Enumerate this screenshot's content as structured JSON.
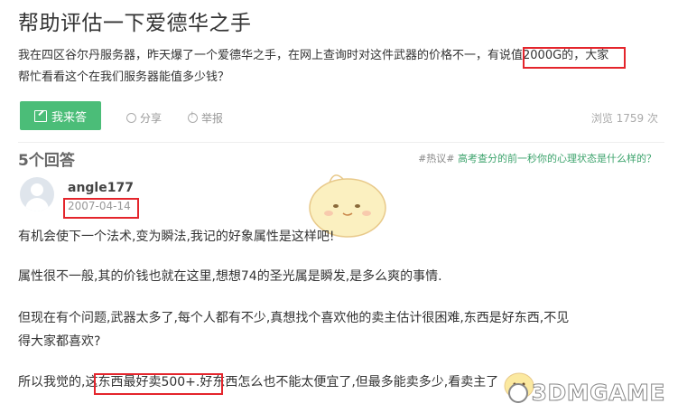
{
  "question": {
    "title": "帮助评估一下爱德华之手",
    "desc_line1_a": "我在四区谷尔丹服务器，昨天爆了一个爱德华之手，在网上查询时对这件武器的价格不一，",
    "desc_line1_b": "有说值2000G的",
    "desc_line1_c": "，大家",
    "desc_line2": "帮忙看看这个在我们服务器能值多少钱？"
  },
  "actions": {
    "answer_label": "我来答",
    "share_label": "分享",
    "report_label": "举报",
    "views": "浏览 1759 次"
  },
  "answers": {
    "count_label": "5个回答",
    "hot_tag": "#热议#",
    "hot_link": "高考查分的前一秒你的心理状态是什么样的？"
  },
  "answer": {
    "username": "angle177",
    "date": "2007-04-14",
    "p1": "有机会使下一个法术,变为瞬法,我记的好象属性是这样吧!",
    "p2": "属性很不一般,其的价钱也就在这里,想想74的圣光属是瞬发,是多么爽的事情.",
    "p3a": "但现在有个问题,武器太多了,每个人都有不少,真想找个喜欢他的卖主估计很困难,东西是好东西,不见",
    "p3b": "得大家都喜欢?",
    "p4a": "所以我觉的,",
    "p4b": "这东西最好卖500+",
    "p4c": ".好东西怎么也不能太便宜了,但最多能卖多少,看卖主了"
  },
  "watermark": "3DMGAME",
  "colors": {
    "highlight": "#e4252c",
    "button": "#4bbd78",
    "link": "#3ca36c"
  }
}
